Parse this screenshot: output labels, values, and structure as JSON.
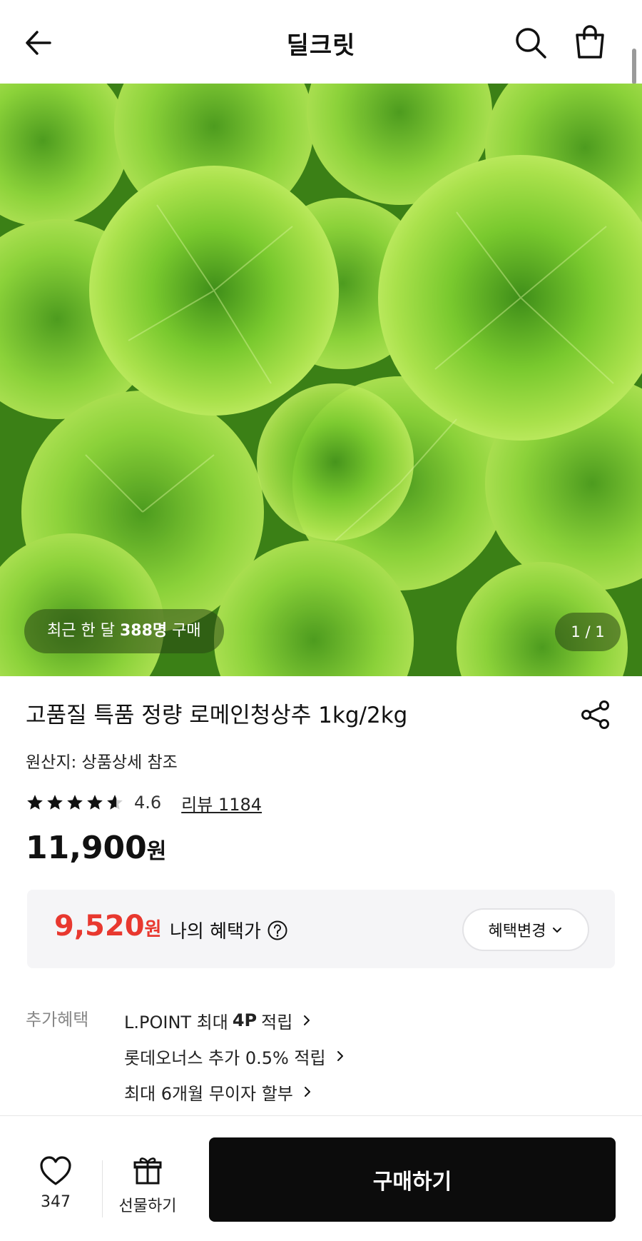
{
  "header": {
    "title": "딜크릿",
    "back_icon": "arrow-left-icon",
    "search_icon": "search-icon",
    "cart_icon": "shopping-bag-icon"
  },
  "hero": {
    "recent_prefix": "최근 한 달",
    "recent_count": "388명",
    "recent_suffix": "구매",
    "page_indicator": "1 / 1"
  },
  "product": {
    "title": "고품질 특품 정량 로메인청상추 1kg/2kg",
    "origin": "원산지: 상품상세 참조",
    "rating": "4.6",
    "rating_value": 4.6,
    "review": "리뷰 1184",
    "price": "11,900",
    "price_unit": "원"
  },
  "benefit": {
    "price": "9,520",
    "price_unit": "원",
    "label": "나의 혜택가",
    "change_button": "혜택변경"
  },
  "extra": {
    "label": "추가혜택",
    "items": [
      {
        "pre": "L.POINT 최대",
        "bold": "4P",
        "post": "적립"
      },
      {
        "pre": "롯데오너스 추가 0.5% 적립",
        "bold": "",
        "post": ""
      },
      {
        "pre": "최대 6개월 무이자 할부",
        "bold": "",
        "post": ""
      }
    ]
  },
  "bottom": {
    "like_count": "347",
    "gift_label": "선물하기",
    "buy_label": "구매하기"
  },
  "colors": {
    "accent_red": "#e8382f",
    "buy_button": "#0c0c0c",
    "benefit_bg": "#f5f5f7"
  }
}
